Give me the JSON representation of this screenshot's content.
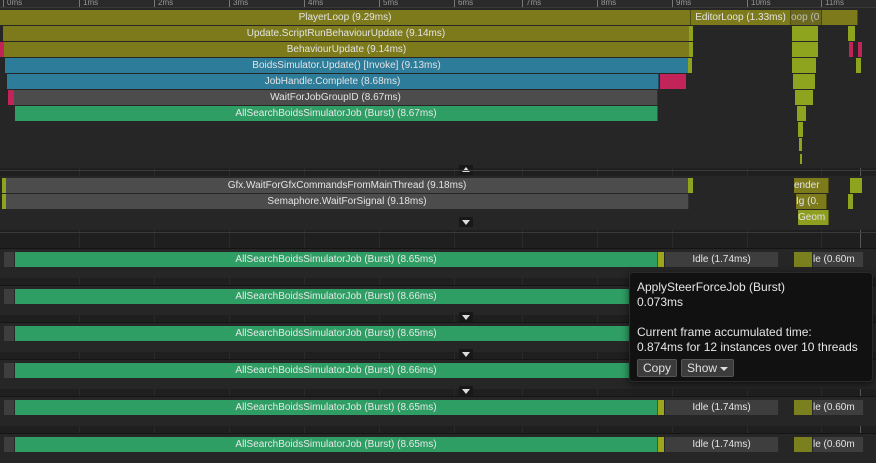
{
  "ruler": {
    "ticks": [
      "0ms",
      "1ms",
      "2ms",
      "3ms",
      "4ms",
      "5ms",
      "6ms",
      "7ms",
      "8ms",
      "9ms",
      "10ms",
      "11ms"
    ]
  },
  "main_thread": {
    "player_loop": "PlayerLoop (9.29ms)",
    "editor_loop": "EditorLoop (1.33ms)",
    "editor_trunc": "oop (0",
    "script_run_update": "Update.ScriptRunBehaviourUpdate (9.14ms)",
    "behaviour_update": "BehaviourUpdate (9.14ms)",
    "boids_update": "BoidsSimulator.Update() [Invoke] (9.13ms)",
    "job_complete": "JobHandle.Complete (8.68ms)",
    "wait_for_job": "WaitForJobGroupID (8.67ms)",
    "search_job": "AllSearchBoidsSimulatorJob (Burst) (8.67ms)"
  },
  "render_thread": {
    "gfx_wait": "Gfx.WaitForGfxCommandsFromMainThread (9.18ms)",
    "semaphore": "Semaphore.WaitForSignal (9.18ms)",
    "render_trunc": "ender",
    "ig_trunc": "Ig (0.",
    "geom_trunc": "Geom"
  },
  "workers": [
    {
      "job": "AllSearchBoidsSimulatorJob (Burst) (8.65ms)",
      "idle": "Idle (1.74ms)",
      "idle2": "le (0.60m"
    },
    {
      "job": "AllSearchBoidsSimulatorJob (Burst) (8.66ms)",
      "idle": "",
      "idle2": ""
    },
    {
      "job": "AllSearchBoidsSimulatorJob (Burst) (8.65ms)",
      "idle": "",
      "idle2": ""
    },
    {
      "job": "AllSearchBoidsSimulatorJob (Burst) (8.66ms)",
      "idle": "",
      "idle2": ""
    },
    {
      "job": "AllSearchBoidsSimulatorJob (Burst) (8.65ms)",
      "idle": "Idle (1.74ms)",
      "idle2": "le (0.60m"
    },
    {
      "job": "AllSearchBoidsSimulatorJob (Burst) (8.65ms)",
      "idle": "Idle (1.74ms)",
      "idle2": "le (0.60m"
    }
  ],
  "tooltip": {
    "name": "ApplySteerForceJob (Burst)",
    "duration": "0.073ms",
    "accum_label": "Current frame accumulated time:",
    "accum_value": "0.874ms for 12 instances over 10 threads",
    "copy_label": "Copy",
    "show_label": "Show"
  },
  "colors": {
    "background": "#1f1f1f",
    "olive": "#7d7a1c",
    "teal": "#2d7c9a",
    "grey": "#4c4c4c",
    "green": "#2f9e64",
    "lime": "#8ea41e",
    "magenta": "#c2245a"
  },
  "icons": [
    "collapse-up-icon",
    "expand-down-icon",
    "chevron-down-icon"
  ]
}
